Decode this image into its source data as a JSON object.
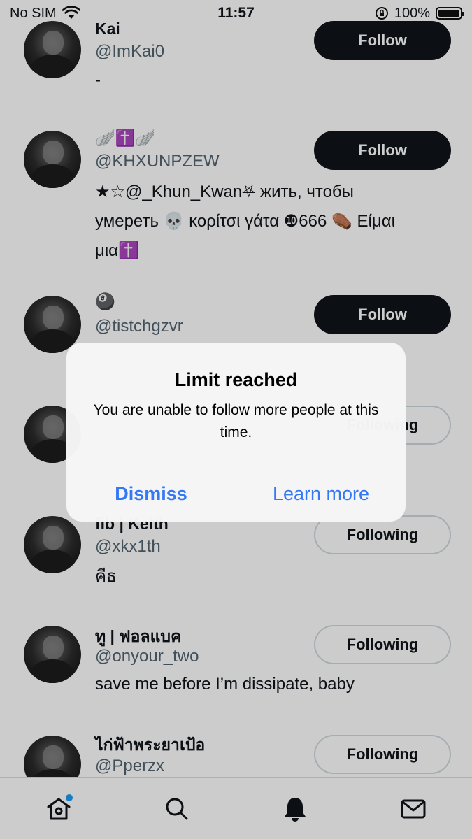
{
  "status_bar": {
    "carrier": "No SIM",
    "time": "11:57",
    "battery": "100%"
  },
  "feed": [
    {
      "name": "Kai",
      "handle": "@ImKai0",
      "bio": "-",
      "button": "Follow"
    },
    {
      "name": "🪽✝️🪽",
      "handle": "@KHXUNPZEW",
      "bio": "★☆@_Khun_Kwan⛧ жить, чтобы умереть 💀 κορίτσι γάτα ❿666 ⚰️ Είμαι μια✝️",
      "button": "Follow"
    },
    {
      "name": "🎱",
      "handle": "@tistchgzvr",
      "bio": "",
      "button": "Follow"
    },
    {
      "name": "",
      "handle": "",
      "bio": "",
      "button": "Following"
    },
    {
      "name": "fib | Keith",
      "handle": "@xkx1th",
      "bio": "คีธ",
      "button": "Following"
    },
    {
      "name": "ทู | ฟอลแบค",
      "handle": "@onyour_two",
      "bio": "save me before I’m dissipate, baby",
      "button": "Following"
    },
    {
      "name": "ไก่ฟ้าพระยาเป้อ",
      "handle": "@Pperzx",
      "bio": "",
      "button": "Following"
    }
  ],
  "alert": {
    "title": "Limit reached",
    "message": "You are unable to follow more people at this time.",
    "dismiss": "Dismiss",
    "learn_more": "Learn more"
  },
  "tab_bar": {
    "items": [
      {
        "icon": "home-icon",
        "badge": true
      },
      {
        "icon": "search-icon",
        "badge": false
      },
      {
        "icon": "bell-icon",
        "badge": false,
        "active": true
      },
      {
        "icon": "mail-icon",
        "badge": false
      }
    ]
  },
  "colors": {
    "accent": "#3478f6",
    "badge": "#1d9bf0",
    "follow_bg": "#0f1419"
  }
}
